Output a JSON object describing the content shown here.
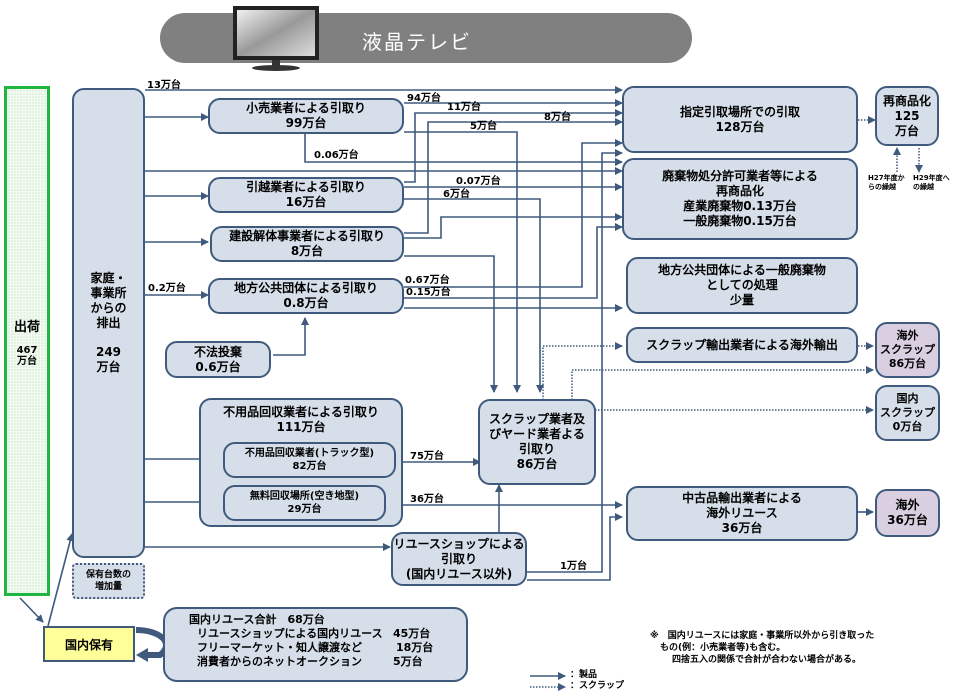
{
  "title": "液晶テレビ",
  "title_icon": "tv-monitor-icon",
  "shipment": {
    "label": "出荷",
    "value": "467",
    "unit": "万台"
  },
  "discharge": {
    "lines": [
      "家庭・",
      "事業所",
      "からの",
      "排出"
    ],
    "value": "249",
    "unit": "万台"
  },
  "holding_increase": {
    "lines": [
      "保有台数の",
      "増加量"
    ]
  },
  "domestic_holding": {
    "label": "国内保有"
  },
  "nodes": {
    "retailer": {
      "name": "小売業者による引取り",
      "value": "99万台"
    },
    "mover": {
      "name": "引越業者による引取り",
      "value": "16万台"
    },
    "construction": {
      "name": "建設解体事業者による引取り",
      "value": "8万台"
    },
    "municipality": {
      "name": "地方公共団体による引取り",
      "value": "0.8万台"
    },
    "illegal_dumping": {
      "name": "不法投棄",
      "value": "0.6万台"
    },
    "junk_collector": {
      "name": "不用品回収業者による引取り",
      "value": "111万台"
    },
    "junk_truck": {
      "name": "不用品回収業者(トラック型)",
      "value": "82万台"
    },
    "free_site": {
      "name": "無料回収場所(空き地型)",
      "value": "29万台"
    },
    "scrap_yard": {
      "lines": [
        "スクラップ業者及",
        "びヤード業者よる",
        "引取り"
      ],
      "value": "86万台"
    },
    "reuse_shop": {
      "lines": [
        "リユースショップによる",
        "引取り",
        "(国内リユース以外)"
      ]
    },
    "designated": {
      "name": "指定引取場所での引取",
      "value": "128万台"
    },
    "waste_license": {
      "lines": [
        "廃棄物処分許可業者等による",
        "再商品化"
      ],
      "industrial": "産業廃棄物0.13万台",
      "general": "一般廃棄物0.15万台"
    },
    "muni_disposal": {
      "lines": [
        "地方公共団体による一般廃棄物",
        "としての処理"
      ],
      "value": "少量"
    },
    "scrap_export": {
      "name": "スクラップ輸出業者による海外輸出"
    },
    "used_export": {
      "lines": [
        "中古品輸出業者による",
        "海外リユース"
      ],
      "value": "36万台"
    },
    "recommercialization": {
      "name": "再商品化",
      "value": "125",
      "unit": "万台"
    },
    "overseas_scrap": {
      "lines": [
        "海外",
        "スクラップ"
      ],
      "value": "86万台"
    },
    "domestic_scrap": {
      "lines": [
        "国内",
        "スクラップ"
      ],
      "value": "0万台"
    },
    "overseas": {
      "name": "海外",
      "value": "36万台"
    }
  },
  "carryover": {
    "from_h27": [
      "H27年度か",
      "らの繰越"
    ],
    "to_h29": [
      "H29年度へ",
      "の繰越"
    ]
  },
  "flow_labels": {
    "f13": "13万台",
    "f94": "94万台",
    "f11": "11万台",
    "f5": "5万台",
    "f8": "8万台",
    "f006": "0.06万台",
    "f007": "0.07万台",
    "f6": "6万台",
    "f02": "0.2万台",
    "f067": "0.67万台",
    "f015": "0.15万台",
    "f75": "75万台",
    "f36": "36万台",
    "f1": "1万台"
  },
  "domestic_reuse": {
    "total": "国内リユース合計　68万台",
    "rows": [
      {
        "label": "リユースショップによる国内リユース",
        "value": "45万台"
      },
      {
        "label": "フリーマーケット・知人譲渡など",
        "value": "18万台"
      },
      {
        "label": "消費者からのネットオークション",
        "value": "5万台"
      }
    ]
  },
  "notes": [
    "※　国内リユースには家庭・事業所以外から引き取った",
    "もの(例：小売業者等)も含む。",
    "四捨五入の関係で合計が合わない場合がある。"
  ],
  "legend": [
    {
      "style": "solid",
      "label": "：製品"
    },
    {
      "style": "dotted",
      "label": "：スクラップ"
    }
  ],
  "colors": {
    "box_fill": "#d6dfe9",
    "box_border": "#3f5a7d",
    "purple_fill": "#d9cfe0",
    "green_border": "#1fb541",
    "yellow_fill": "#ffff99",
    "title_bar": "#808080"
  }
}
